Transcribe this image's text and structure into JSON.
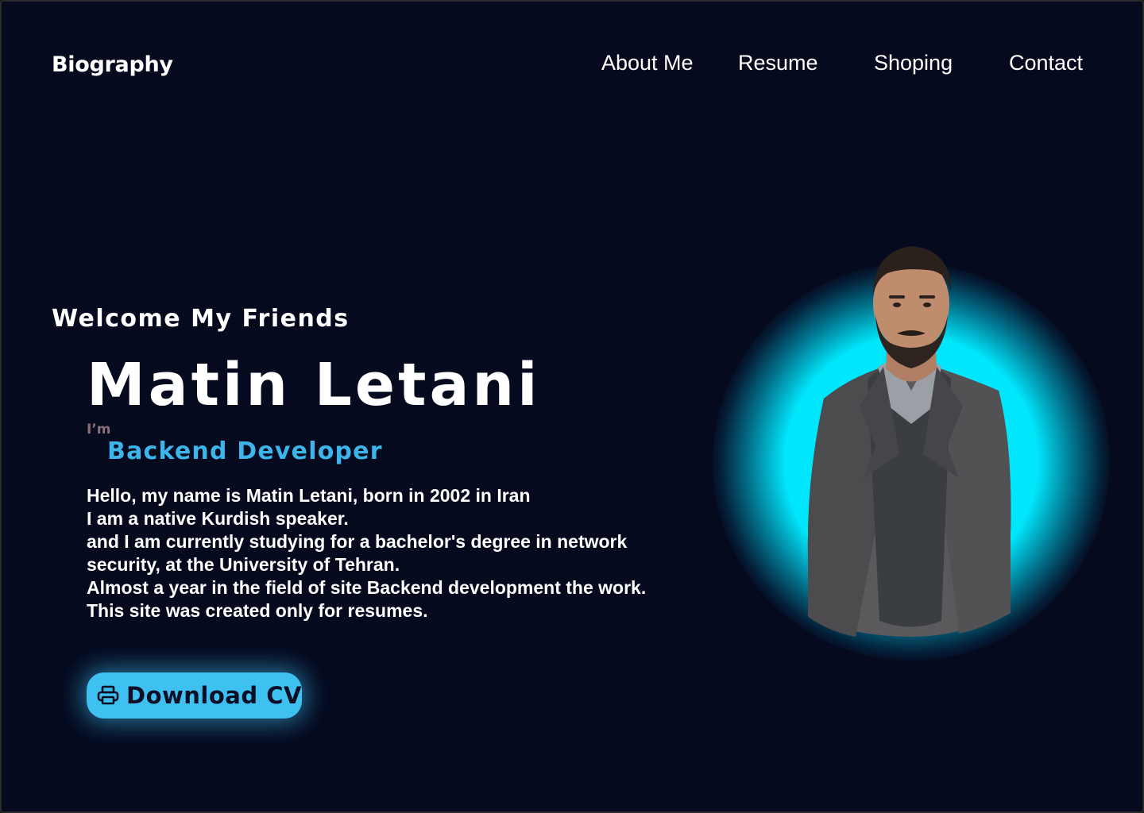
{
  "header": {
    "logo": "Biography",
    "nav": [
      {
        "label": "About Me"
      },
      {
        "label": "Resume"
      },
      {
        "label": "Shoping"
      },
      {
        "label": "Contact"
      }
    ]
  },
  "hero": {
    "welcome": "Welcome My Friends",
    "name": "Matin Letani",
    "im": "I’m",
    "role": "Backend Developer",
    "bio": [
      "Hello, my name is Matin Letani, born in 2002 in Iran",
      "I am a native Kurdish speaker.",
      "and I am currently studying for a bachelor's degree in network",
      "security, at the University of Tehran.",
      "Almost a year in the field of site Backend development the work.",
      "This site was created only for resumes."
    ],
    "download_label": "Download CV",
    "download_icon": "printer-icon"
  },
  "colors": {
    "background": "#050a1f",
    "accent": "#3db4ea",
    "glow": "#00eaff",
    "im_text": "#8a6e78"
  }
}
